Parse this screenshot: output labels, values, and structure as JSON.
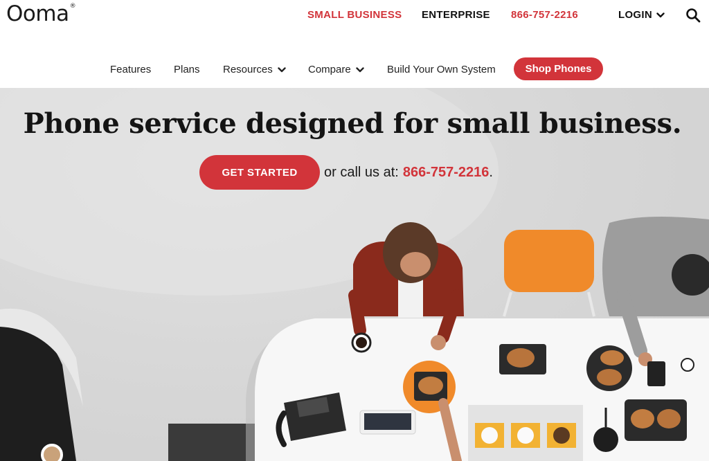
{
  "header": {
    "logo_text": "Ooma",
    "logo_mark": "®",
    "links": {
      "small_business": "SMALL BUSINESS",
      "enterprise": "ENTERPRISE",
      "phone": "866-757-2216",
      "login": "LOGIN"
    },
    "icons": {
      "login_chevron": "chevron-down-icon",
      "search": "search-icon"
    }
  },
  "subnav": {
    "features": "Features",
    "plans": "Plans",
    "resources": "Resources",
    "compare": "Compare",
    "build": "Build Your Own System",
    "shop": "Shop Phones"
  },
  "hero": {
    "title": "Phone service designed for small business.",
    "cta_label": "GET STARTED",
    "call_text": "or call us at:",
    "call_phone": "866-757-2216",
    "call_suffix": "."
  },
  "colors": {
    "brand_red": "#d2343a",
    "text_dark": "#111111",
    "hero_bg": "#d8d8d8"
  }
}
